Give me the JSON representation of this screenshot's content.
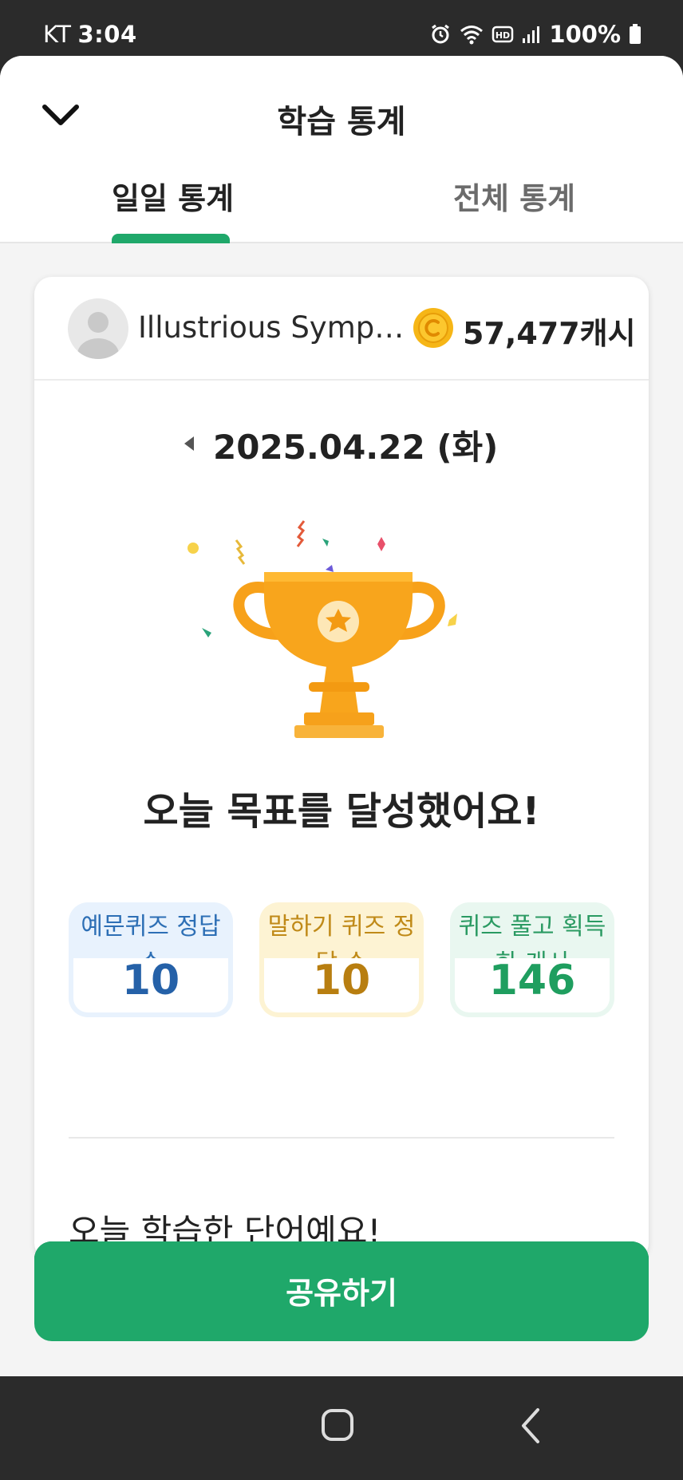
{
  "status_bar": {
    "carrier": "KT",
    "time": "3:04",
    "battery": "100%"
  },
  "header": {
    "title": "학습 통계",
    "tabs": [
      {
        "label": "일일 통계",
        "active": true
      },
      {
        "label": "전체 통계",
        "active": false
      }
    ]
  },
  "profile": {
    "username": "Illustrious Sympa...",
    "cash": "57,477캐시"
  },
  "date": "2025.04.22 (화)",
  "achievement": "오늘 목표를 달성했어요!",
  "stats": [
    {
      "label": "예문퀴즈 정답 수",
      "value": "10",
      "color": "#2561a8"
    },
    {
      "label": "말하기 퀴즈 정답 수",
      "value": "10",
      "color": "#b87e10"
    },
    {
      "label": "퀴즈 풀고 획득한 캐시",
      "value": "146",
      "color": "#1f9e5f"
    }
  ],
  "words_heading": "오늘 학습한 단어예요!",
  "share_button": "공유하기",
  "colors": {
    "accent": "#1fa86a",
    "coin": "#f6b617"
  },
  "icons": {
    "collapse": "chevron-down-icon",
    "prev_date": "caret-left-icon",
    "coin": "coin-icon",
    "trophy": "trophy-illustration",
    "nav_home": "home-square-icon",
    "nav_back": "back-chevron-icon"
  }
}
